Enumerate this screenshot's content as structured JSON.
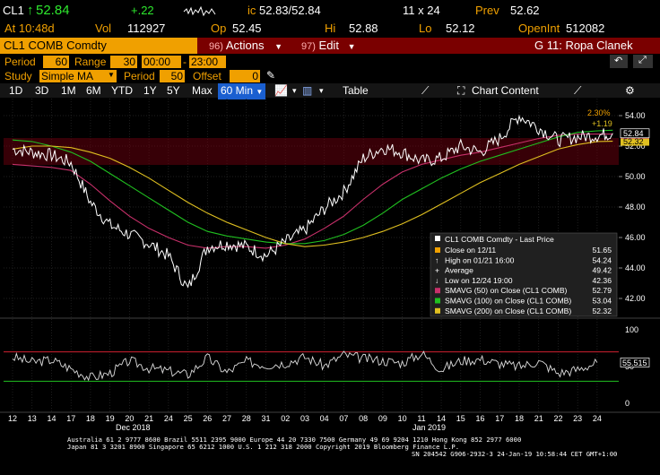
{
  "header": {
    "ticker": "CL1",
    "last_arrow": "↑",
    "last": "52.84",
    "change": "+.22",
    "vol_label": "Vol",
    "vol": "112927",
    "ic_label": "ic",
    "bid_ask": "52.83/52.84",
    "size": "11 x 24",
    "prev_label": "Prev",
    "prev": "52.62",
    "time_label": "At 10:48d",
    "open_label": "Op",
    "open": "52.45",
    "high_label": "Hi",
    "high": "52.88",
    "low_label": "Lo",
    "low": "52.12",
    "openint_label": "OpenInt",
    "openint": "512082"
  },
  "titlebar": {
    "security": "CL1 COMB Comdty",
    "actions_num": "96)",
    "actions": "Actions",
    "edit_num": "97)",
    "edit": "Edit",
    "chart_name": "G 11: Ropa Clanek"
  },
  "settings": {
    "period_label": "Period",
    "period": "60",
    "range_label": "Range",
    "range": "30",
    "start_time": "00:00",
    "dash": "-",
    "end_time": "23:00",
    "study_label": "Study",
    "study": "Simple MA",
    "study_period_label": "Period",
    "study_period": "50",
    "offset_label": "Offset",
    "offset": "0"
  },
  "toolbar": {
    "ranges": [
      "1D",
      "3D",
      "1M",
      "6M",
      "YTD",
      "1Y",
      "5Y",
      "Max"
    ],
    "interval": "60 Min",
    "table": "Table",
    "chart_content": "Chart Content"
  },
  "colors": {
    "amber": "#f0a000",
    "price": "#ffffff",
    "sma50": "#c8306a",
    "sma100": "#20c020",
    "sma200": "#e0c020",
    "band": "#7a0010"
  },
  "chart_data": [
    {
      "type": "line",
      "ylim": [
        41,
        55
      ],
      "yticks": [
        42,
        44,
        46,
        48,
        50,
        52,
        54
      ],
      "x_day_labels": [
        "12",
        "13",
        "14",
        "17",
        "18",
        "19",
        "20",
        "21",
        "24",
        "25",
        "26",
        "27",
        "28",
        "31",
        "02",
        "03",
        "04",
        "07",
        "08",
        "09",
        "10",
        "11",
        "14",
        "15",
        "16",
        "17",
        "18",
        "21",
        "22",
        "23",
        "24"
      ],
      "x_month_labels": [
        "Dec 2018",
        "Jan 2019"
      ],
      "price_series": {
        "x": [
          0,
          1,
          2,
          3,
          4,
          5,
          6,
          7,
          8,
          9,
          10,
          11,
          12,
          13,
          14,
          15,
          16,
          17,
          18,
          19,
          20,
          21,
          22,
          23,
          24,
          25,
          26,
          27,
          28,
          29,
          30,
          30.8
        ],
        "values": [
          51.8,
          51.6,
          51.4,
          50.9,
          48.3,
          46.8,
          46.2,
          45.6,
          44.8,
          42.6,
          45.4,
          45.6,
          45.4,
          44.8,
          45.7,
          46.5,
          47.9,
          49.0,
          51.2,
          51.9,
          51.6,
          51.0,
          51.2,
          52.0,
          51.6,
          52.5,
          54.0,
          53.2,
          52.4,
          52.6,
          52.7,
          52.84
        ]
      },
      "sma": [
        {
          "name": "SMAVG (50)",
          "values": [
            50.8,
            50.7,
            50.6,
            50.4,
            49.5,
            48.4,
            47.4,
            46.6,
            46.0,
            45.5,
            45.3,
            45.4,
            45.4,
            45.3,
            45.5,
            45.9,
            46.6,
            47.4,
            48.5,
            49.5,
            50.3,
            50.8,
            51.1,
            51.4,
            51.6,
            51.9,
            52.2,
            52.5,
            52.7,
            52.78,
            52.79,
            52.79
          ]
        },
        {
          "name": "SMAVG (100)",
          "values": [
            52.4,
            52.3,
            52.0,
            51.6,
            51.0,
            50.2,
            49.4,
            48.6,
            47.8,
            47.0,
            46.4,
            46.1,
            45.9,
            45.7,
            45.6,
            45.6,
            45.8,
            46.2,
            46.8,
            47.6,
            48.5,
            49.2,
            49.9,
            50.5,
            51.0,
            51.4,
            51.8,
            52.2,
            52.6,
            52.9,
            53.0,
            53.04
          ]
        },
        {
          "name": "SMAVG (200)",
          "values": [
            51.8,
            52.0,
            52.0,
            51.9,
            51.6,
            51.2,
            50.6,
            49.9,
            49.1,
            48.3,
            47.6,
            47.0,
            46.5,
            46.0,
            45.6,
            45.4,
            45.5,
            45.7,
            46.0,
            46.4,
            46.9,
            47.5,
            48.2,
            48.9,
            49.6,
            50.2,
            50.8,
            51.3,
            51.8,
            52.1,
            52.3,
            52.32
          ]
        }
      ],
      "price_labels": {
        "current": "52.84",
        "sma100_label": "53.04",
        "pct": "2.30%",
        "chg": "+1.19",
        "sma50_label": "52.79",
        "sma200_label": "52.32"
      },
      "legend": {
        "title": "CL1 COMB Comdty - Last Price",
        "rows": [
          {
            "label": "Close on 12/11",
            "value": "51.65",
            "swatch": "#f0a000"
          },
          {
            "label": "High on 01/21 16:00",
            "value": "54.24",
            "swatch": ""
          },
          {
            "label": "Average",
            "value": "49.42",
            "swatch": ""
          },
          {
            "label": "Low on 12/24 19:00",
            "value": "42.36",
            "swatch": ""
          },
          {
            "label": "SMAVG (50)  on Close (CL1 COMB)",
            "value": "52.79",
            "swatch": "#c8306a"
          },
          {
            "label": "SMAVG (100)  on Close (CL1 COMB)",
            "value": "53.04",
            "swatch": "#20c020"
          },
          {
            "label": "SMAVG (200)  on Close (CL1 COMB)",
            "value": "52.32",
            "swatch": "#e0c020"
          }
        ]
      }
    },
    {
      "type": "line",
      "name": "RSI",
      "ylim": [
        0,
        100
      ],
      "yticks": [
        0,
        50,
        100
      ],
      "bands": [
        70,
        30
      ],
      "current": "55.515",
      "values": [
        63,
        56,
        59,
        47,
        35,
        41,
        58,
        48,
        44,
        39,
        62,
        42,
        57,
        52,
        55,
        63,
        51,
        66,
        61,
        58,
        55,
        68,
        46,
        58,
        60,
        54,
        50,
        57,
        41,
        46,
        55.5
      ]
    }
  ],
  "footer": {
    "line1": "Australia 61 2 9777 8600 Brazil 5511 2395 9000 Europe 44 20 7330 7500 Germany 49 69 9204 1210 Hong Kong 852 2977 6000",
    "line2": "Japan 81 3 3201 8900         Singapore 65 6212 1000         U.S. 1 212 318 2000         Copyright 2019 Bloomberg Finance L.P.",
    "line3": "SN 204542 G906-2932-3 24-Jan-19 10:58:44 CET  GMT+1:00"
  }
}
